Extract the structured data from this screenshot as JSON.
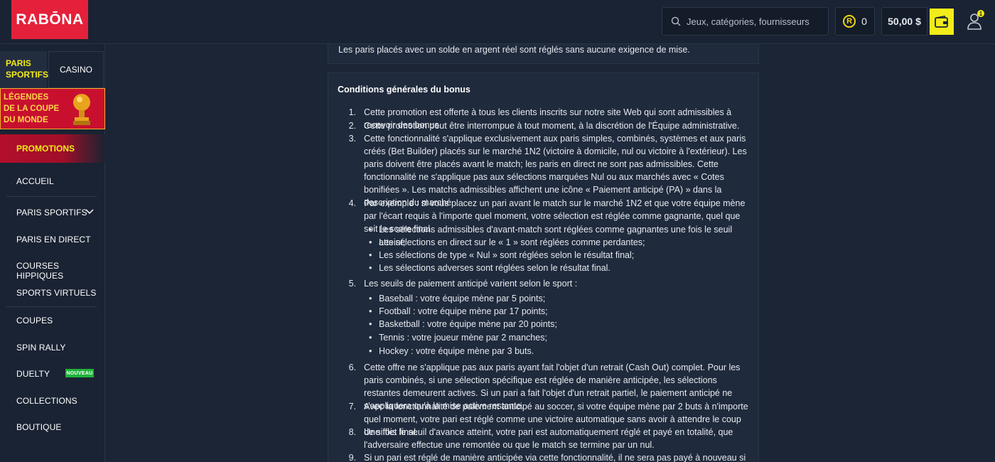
{
  "header": {
    "logo": "RABŌNA",
    "search_placeholder": "Jeux, catégories, fournisseurs",
    "coins": "0",
    "balance": "50,00 $",
    "user_badge": "1"
  },
  "sidebar": {
    "tab_sport": "PARIS SPORTIFS",
    "tab_casino": "CASINO",
    "legends": "LÉGENDES DE LA COUPE DU MONDE",
    "promotions": "PROMOTIONS",
    "items": [
      "ACCUEIL",
      "PARIS SPORTIFS",
      "PARIS EN DIRECT",
      "COURSES HIPPIQUES",
      "SPORTS VIRTUELS",
      "COUPES",
      "SPIN RALLY",
      "DUELTY",
      "COLLECTIONS",
      "BOUTIQUE"
    ],
    "new_badge": "NOUVEAU"
  },
  "content": {
    "top_text": "Les paris placés avec un solde en argent réel sont réglés sans aucune exigence de mise.",
    "title": "Conditions générales du bonus",
    "items": [
      {
        "n": "1.",
        "text": "Cette promotion est offerte à tous les clients inscrits sur notre site Web qui sont admissibles à recevoir des bonus."
      },
      {
        "n": "2.",
        "text": "Cette promotion peut être interrompue à tout moment, à la discrétion de l'Équipe administrative."
      },
      {
        "n": "3.",
        "text": "Cette fonctionnalité s'applique exclusivement aux paris simples, combinés, systèmes et aux paris créés (Bet Builder) placés sur le marché 1N2 (victoire à domicile, nul ou victoire à l'extérieur). Les paris doivent être placés avant le match; les paris en direct ne sont pas admissibles. Cette fonctionnalité ne s'applique pas aux sélections marquées Nul ou aux marchés avec « Cotes bonifiées ». Les matchs admissibles affichent une icône « Paiement anticipé (PA) » dans la description du marché."
      },
      {
        "n": "4.",
        "text": "Par exemple : si vous placez un pari avant le match sur le marché 1N2 et que votre équipe mène par l'écart requis à l'importe quel moment, votre sélection est réglée comme gagnante, quel que soit le score final."
      },
      {
        "n": "5.",
        "text": "Les seuils de paiement anticipé varient selon le sport :"
      },
      {
        "n": "6.",
        "text": "Cette offre ne s'applique pas aux paris ayant fait l'objet d'un retrait (Cash Out) complet. Pour les paris combinés, si une sélection spécifique est réglée de manière anticipée, les sélections restantes demeurent actives. Si un pari a fait l'objet d'un retrait partiel, le paiement anticipé ne s'appliquera qu'à la mise active restante."
      },
      {
        "n": "7.",
        "text": "Avec la fonctionnalité de paiement anticipé au soccer, si votre équipe mène par 2 buts à n'importe quel moment, votre pari est réglé comme une victoire automatique sans avoir à attendre le coup de sifflet final."
      },
      {
        "n": "8.",
        "text": "Une fois le seuil d'avance atteint, votre pari est automatiquement réglé et payé en totalité, que l'adversaire effectue une remontée ou que le match se termine par un nul."
      },
      {
        "n": "9.",
        "text": "Si un pari est réglé de manière anticipée via cette fonctionnalité, il ne sera pas payé à nouveau si la sélection remporte"
      }
    ],
    "bullets_4": [
      "Les sélections admissibles d'avant-match sont réglées comme gagnantes une fois le seuil atteint;",
      "Les sélections en direct sur le « 1 » sont réglées comme perdantes;",
      "Les sélections de type « Nul » sont réglées selon le résultat final;",
      "Les sélections adverses sont réglées selon le résultat final."
    ],
    "bullets_5": [
      "Baseball : votre équipe mène par 5 points;",
      "Football : votre équipe mène par 17 points;",
      "Basketball : votre équipe mène par 20 points;",
      "Tennis : votre joueur mène par 2 manches;",
      "Hockey : votre équipe mène par 3 buts."
    ]
  }
}
